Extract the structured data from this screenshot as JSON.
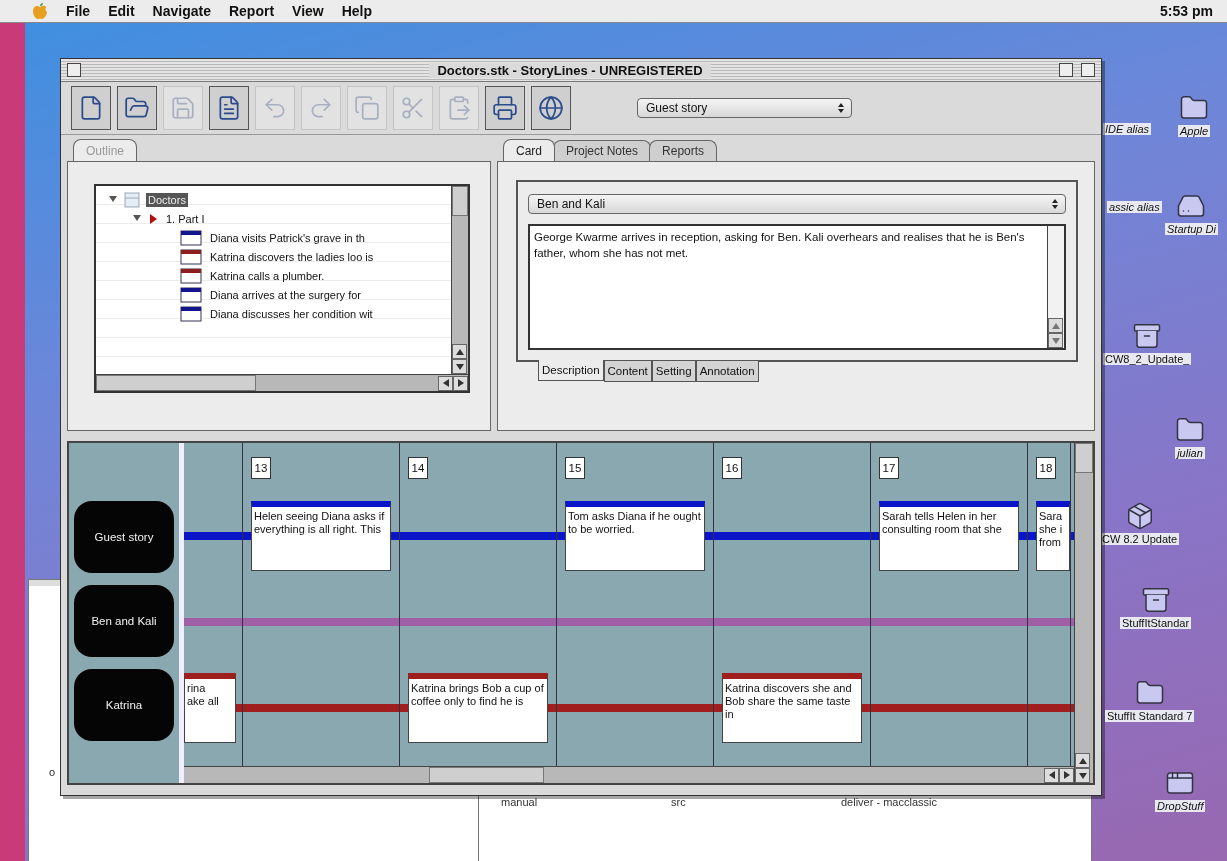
{
  "menu_bar": {
    "items": [
      "File",
      "Edit",
      "Navigate",
      "Report",
      "View",
      "Help"
    ],
    "clock": "5:53 pm"
  },
  "desktop_icons": [
    {
      "label": "IDE alias",
      "kind": "covered",
      "alias": true
    },
    {
      "label": "Apple",
      "kind": "folder",
      "alias": true
    },
    {
      "label": "assic alias",
      "kind": "covered",
      "alias": true
    },
    {
      "label": "Startup Di",
      "kind": "disk",
      "alias": true
    },
    {
      "label": "CW8_2_Update_",
      "kind": "archive",
      "alias": false
    },
    {
      "label": "julian",
      "kind": "folder",
      "alias": true
    },
    {
      "label": "CW 8.2 Update",
      "kind": "installer",
      "alias": false
    },
    {
      "label": "StuffItStandar",
      "kind": "archive",
      "alias": false
    },
    {
      "label": "StuffIt Standard 7",
      "kind": "folder",
      "alias": false
    },
    {
      "label": "DropStuff",
      "kind": "app",
      "alias": true
    }
  ],
  "background_windows": [
    {
      "texts": [
        "o"
      ]
    },
    {
      "texts": [
        "manual",
        "src",
        "deliver - macclassic"
      ]
    }
  ],
  "window": {
    "title": "Doctors.stk - StoryLines - UNREGISTERED"
  },
  "toolbar": {
    "buttons": [
      {
        "kind": "new",
        "disabled": false
      },
      {
        "kind": "open",
        "disabled": false
      },
      {
        "kind": "save",
        "disabled": true
      },
      {
        "kind": "page",
        "disabled": false
      },
      {
        "kind": "undo",
        "disabled": true
      },
      {
        "kind": "redo",
        "disabled": true
      },
      {
        "kind": "copy",
        "disabled": true
      },
      {
        "kind": "cut",
        "disabled": true
      },
      {
        "kind": "paste",
        "disabled": true
      },
      {
        "kind": "print",
        "disabled": false
      },
      {
        "kind": "globe",
        "disabled": false
      }
    ],
    "storyline_select": "Guest story"
  },
  "outline": {
    "tabs": [
      {
        "label": "Outline",
        "selected": true
      }
    ],
    "tree": [
      {
        "label": "Doctors",
        "kind": "project",
        "selected": true,
        "expanded": true,
        "children": [
          {
            "label": "1. Part I",
            "kind": "part",
            "selected": false,
            "expanded": true,
            "children": [
              {
                "label": "Diana visits Patrick's grave in th",
                "kind": "card",
                "color": "#14148c",
                "selected": false
              },
              {
                "label": "Katrina discovers the ladies loo is",
                "kind": "card",
                "color": "#8c1e1e",
                "selected": false
              },
              {
                "label": "Katrina calls a plumber.",
                "kind": "card",
                "color": "#8c1e1e",
                "selected": false
              },
              {
                "label": "Diana arrives at the surgery for",
                "kind": "card",
                "color": "#14148c",
                "selected": false
              },
              {
                "label": "Diana discusses her condition wit",
                "kind": "card",
                "color": "#14148c",
                "selected": false
              }
            ]
          }
        ]
      }
    ]
  },
  "card_panel": {
    "tabs": [
      {
        "label": "Card",
        "selected": true
      },
      {
        "label": "Project Notes",
        "selected": false
      },
      {
        "label": "Reports",
        "selected": false
      }
    ],
    "storyline": "Ben and Kali",
    "description": "George Kwarme arrives in reception, asking for Ben. Kali overhears and realises that he is Ben's father, whom she has not met.",
    "subtabs": [
      {
        "label": "Description",
        "selected": true
      },
      {
        "label": "Content",
        "selected": false
      },
      {
        "label": "Setting",
        "selected": false
      },
      {
        "label": "Annotation",
        "selected": false
      }
    ]
  },
  "timeline": {
    "storylines": [
      {
        "name": "Guest story",
        "color": "#0a14c8"
      },
      {
        "name": "Ben and Kali",
        "color": "#a060a8"
      },
      {
        "name": "Katrina",
        "color": "#a01e1e"
      }
    ],
    "columns": [
      {
        "kind": "partial-start",
        "cells": [
          {
            "kind": "empty"
          },
          {
            "kind": "empty"
          },
          {
            "kind": "card",
            "text": "rina\nake all"
          }
        ]
      },
      {
        "kind": "full",
        "number": "13",
        "cells": [
          {
            "kind": "card",
            "text": "Helen seeing Diana asks if everything is all right. This"
          },
          {
            "kind": "empty"
          },
          {
            "kind": "empty"
          }
        ]
      },
      {
        "kind": "full",
        "number": "14",
        "cells": [
          {
            "kind": "empty"
          },
          {
            "kind": "empty"
          },
          {
            "kind": "card",
            "text": "Katrina brings Bob a cup of coffee only to find he is"
          }
        ]
      },
      {
        "kind": "full",
        "number": "15",
        "cells": [
          {
            "kind": "card",
            "text": "Tom asks Diana if he ought to be worried."
          },
          {
            "kind": "empty"
          },
          {
            "kind": "empty"
          }
        ]
      },
      {
        "kind": "full",
        "number": "16",
        "cells": [
          {
            "kind": "empty"
          },
          {
            "kind": "empty"
          },
          {
            "kind": "card",
            "text": "Katrina discovers she and Bob share the same taste in"
          }
        ]
      },
      {
        "kind": "full",
        "number": "17",
        "cells": [
          {
            "kind": "card",
            "text": "Sarah tells Helen in her consulting room that she"
          },
          {
            "kind": "empty"
          },
          {
            "kind": "empty"
          }
        ]
      },
      {
        "kind": "partial-end",
        "number": "18",
        "cells": [
          {
            "kind": "card",
            "text": "Sara\nshe i\nfrom"
          },
          {
            "kind": "empty"
          },
          {
            "kind": "empty"
          }
        ]
      }
    ]
  }
}
